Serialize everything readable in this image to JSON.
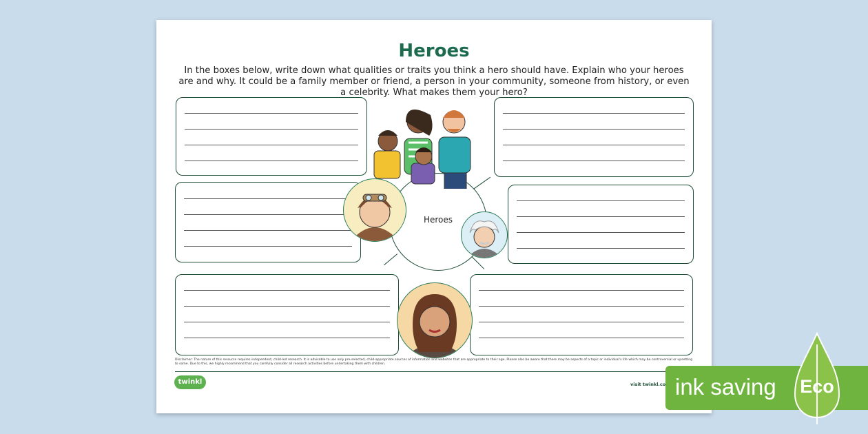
{
  "worksheet": {
    "title": "Heroes",
    "intro": "In the boxes below, write down what qualities or traits you think a hero should have. Explain who your heroes are and why. It could be a family member or friend, a person in your community, someone from history, or even a celebrity. What makes them your hero?",
    "hub_label": "Heroes",
    "disclaimer": "Disclaimer: The nature of this resource requires independent, child-led research. It is advisable to use only pre-selected, child-appropriate sources of information and websites that are appropriate to their age. Please also be aware that there may be aspects of a topic or individual's life which may be controversial or upsetting to some. Due to this, we highly recommend that you carefully consider all research activities before undertaking them with children.",
    "logo_text": "twinkl",
    "visit_text": "visit twinkl.com"
  },
  "badge": {
    "ink_saving": "ink saving",
    "eco": "Eco"
  },
  "illustrations": {
    "family": "family-group-illustration",
    "aviator": "aviator-portrait",
    "scientist": "scientist-portrait",
    "celebrity": "celebrity-portrait"
  },
  "colors": {
    "title": "#1d6b4f",
    "border": "#1e4d36",
    "eco_green": "#6fb43f",
    "background": "#c9dcec"
  }
}
